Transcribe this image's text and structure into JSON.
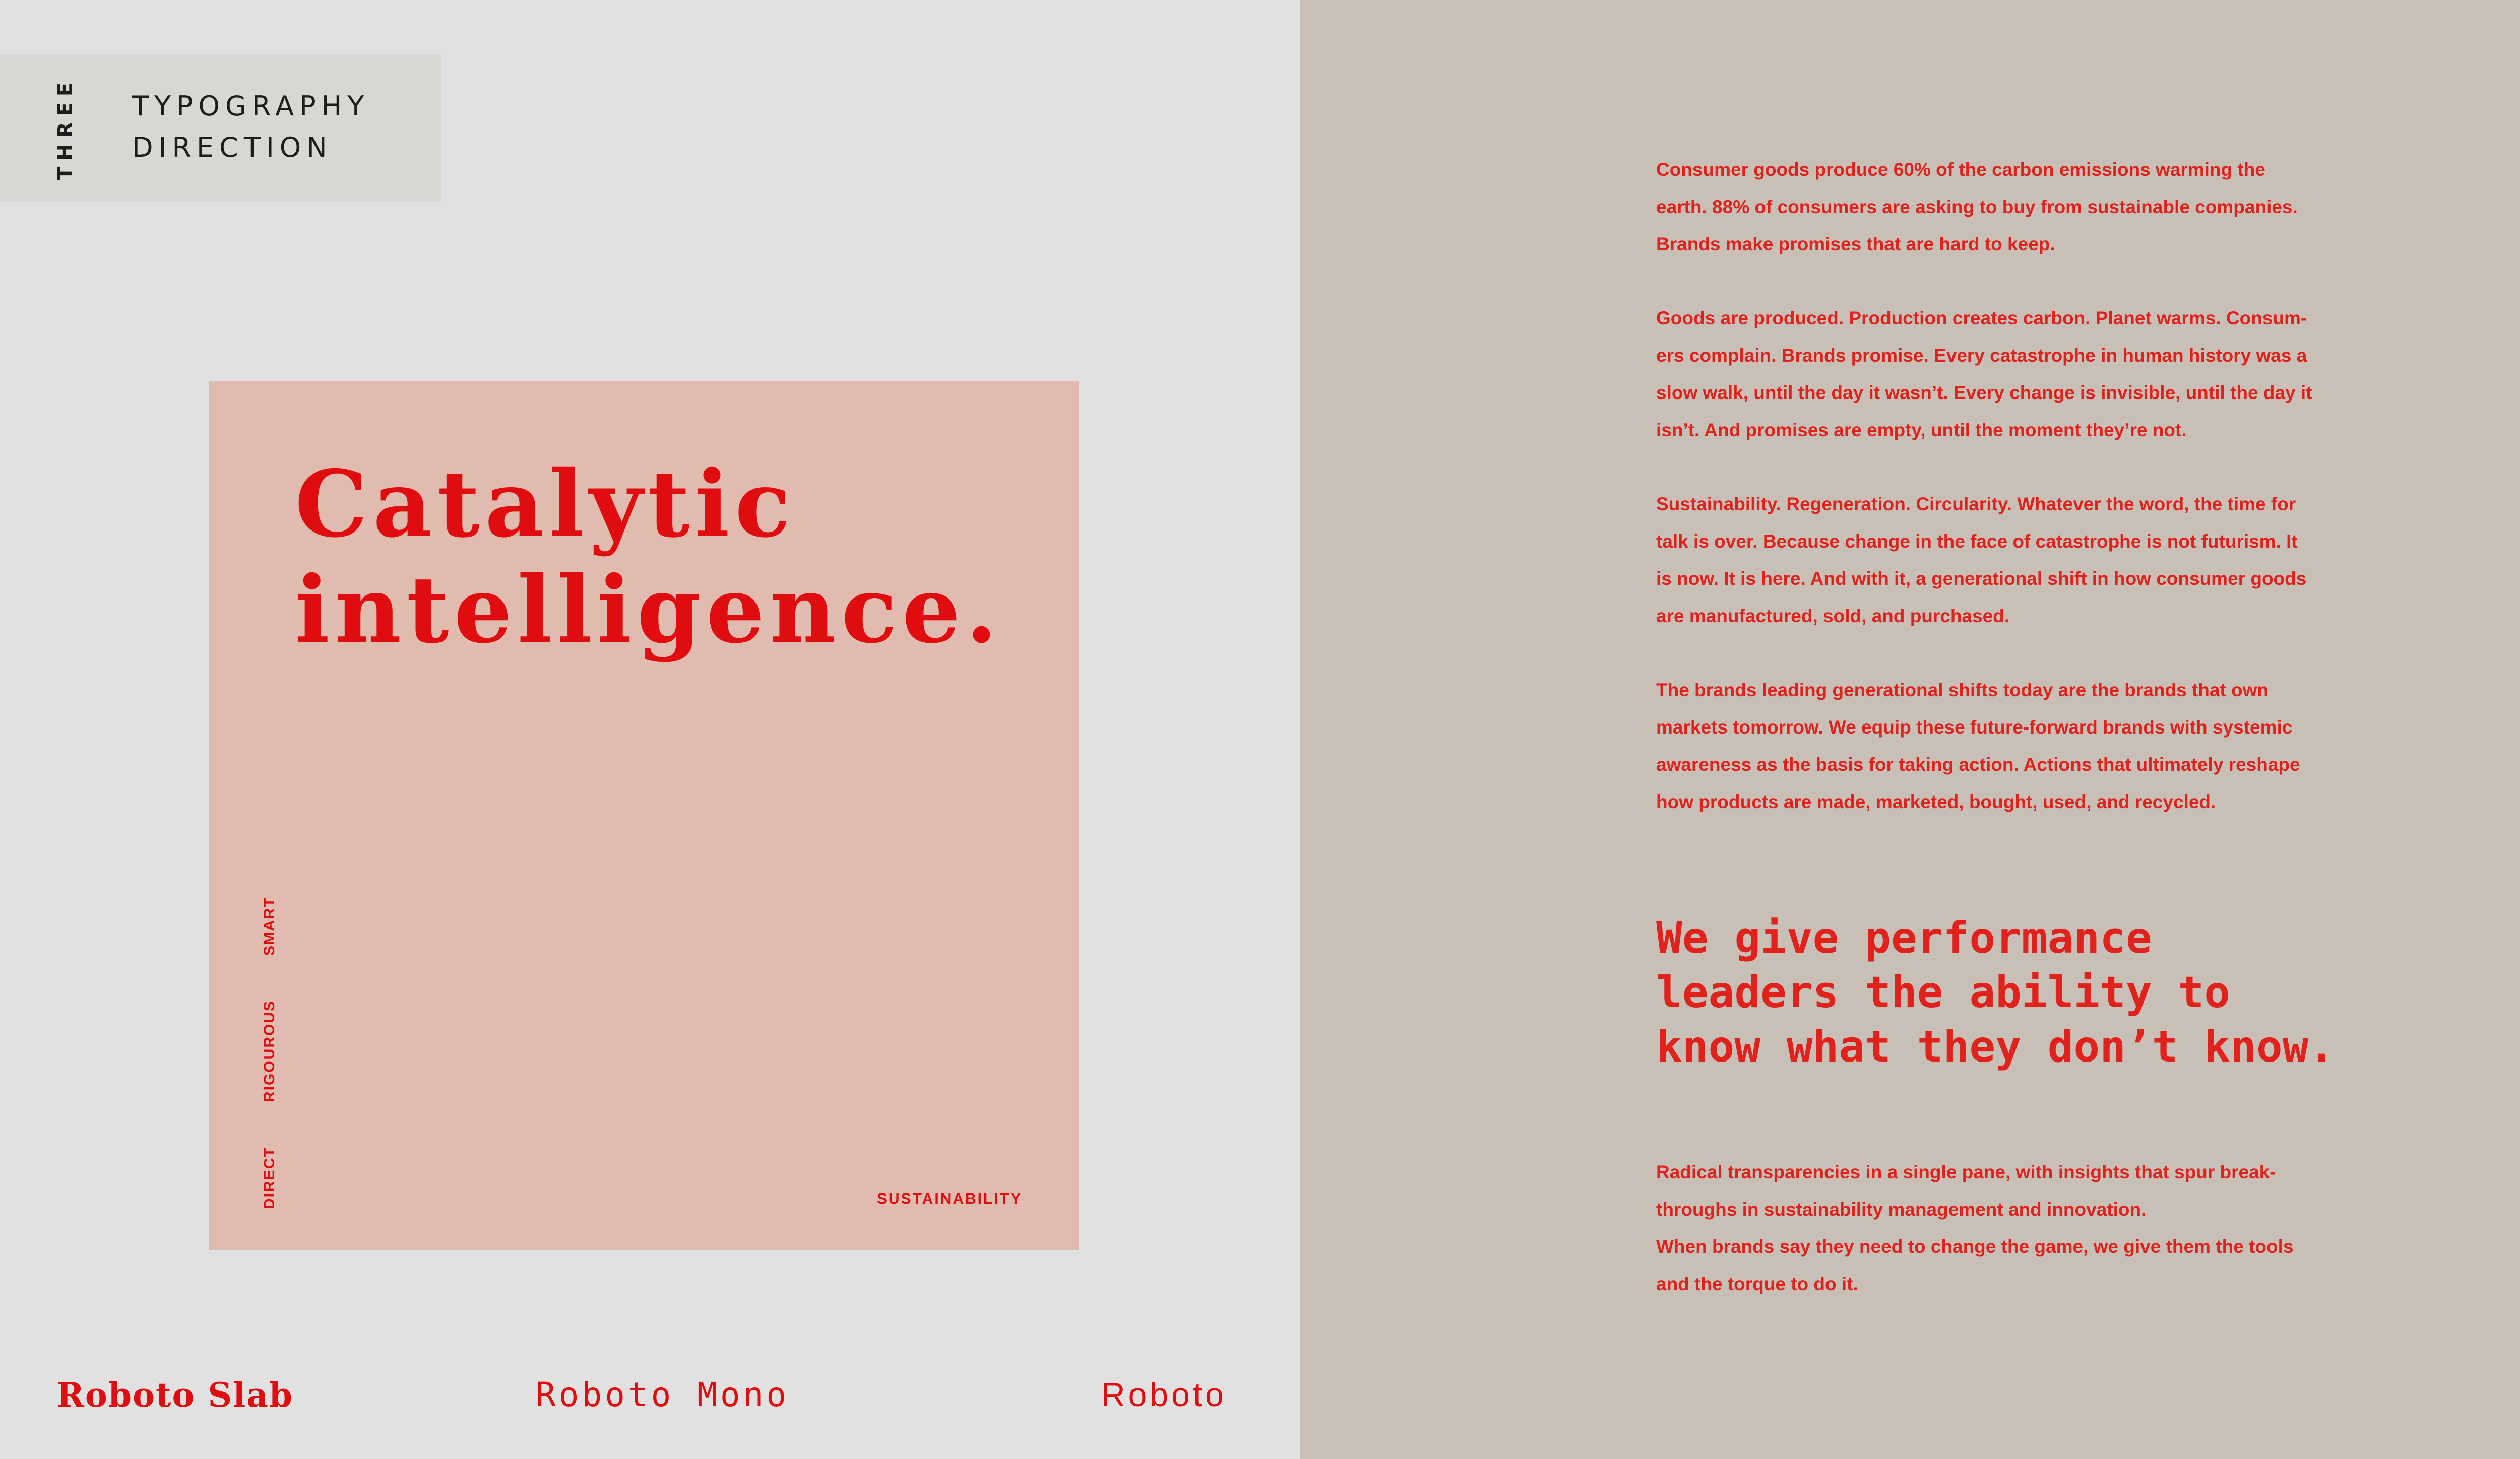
{
  "section": {
    "number": "THREE",
    "title_line_1": "TYPOGRAPHY",
    "title_line_2": "DIRECTION"
  },
  "card": {
    "headline_line_1": "Catalytic",
    "headline_line_2": "intelligence.",
    "vertical_words": [
      "DIRECT",
      "RIGOUROUS",
      "SMART"
    ],
    "tag": "SUSTAINABILITY"
  },
  "fonts": {
    "slab": "Roboto Slab",
    "mono": "Roboto Mono",
    "sans": "Roboto"
  },
  "copy": {
    "p1": [
      "Consumer goods produce 60% of the carbon emissions warming the",
      "earth. 88% of consumers are  asking to buy from sustainable companies.",
      "Brands make promises that are hard to keep."
    ],
    "p2": [
      "Goods are produced. Production creates carbon. Planet warms. Consum-",
      "ers complain. Brands promise. Every catastrophe in human history was a",
      "slow walk, until the day it wasn’t. Every change is invisible, until the day it",
      "isn’t. And promises are empty, until the moment they’re not."
    ],
    "p3": [
      "Sustainability. Regeneration. Circularity. Whatever the word, the time for",
      "talk is over. Because change in the face of catastrophe is not futurism. It",
      "is now. It is here. And with it, a generational shift in how consumer goods",
      "are manufactured, sold, and purchased."
    ],
    "p4": [
      "The brands leading generational shifts today are the brands that own",
      "markets tomorrow. We equip these future-forward brands with systemic",
      "awareness as the basis for taking action. Actions that ultimately reshape",
      "how products are made, marketed, bought, used, and recycled."
    ],
    "statement": [
      "We give performance",
      "leaders the ability to",
      "know what they don’t know."
    ],
    "p5": [
      "Radical transparencies in a single pane, with insights that spur break-",
      "throughs in sustainability management and innovation.",
      "When brands say they need to change the game, we give them the tools",
      "and the torque to do it."
    ]
  },
  "colors": {
    "accent_red": "#e00d10",
    "left_background": "#e1e1e1",
    "right_background": "#c8bfb6",
    "card_background": "#e1bbaf"
  }
}
